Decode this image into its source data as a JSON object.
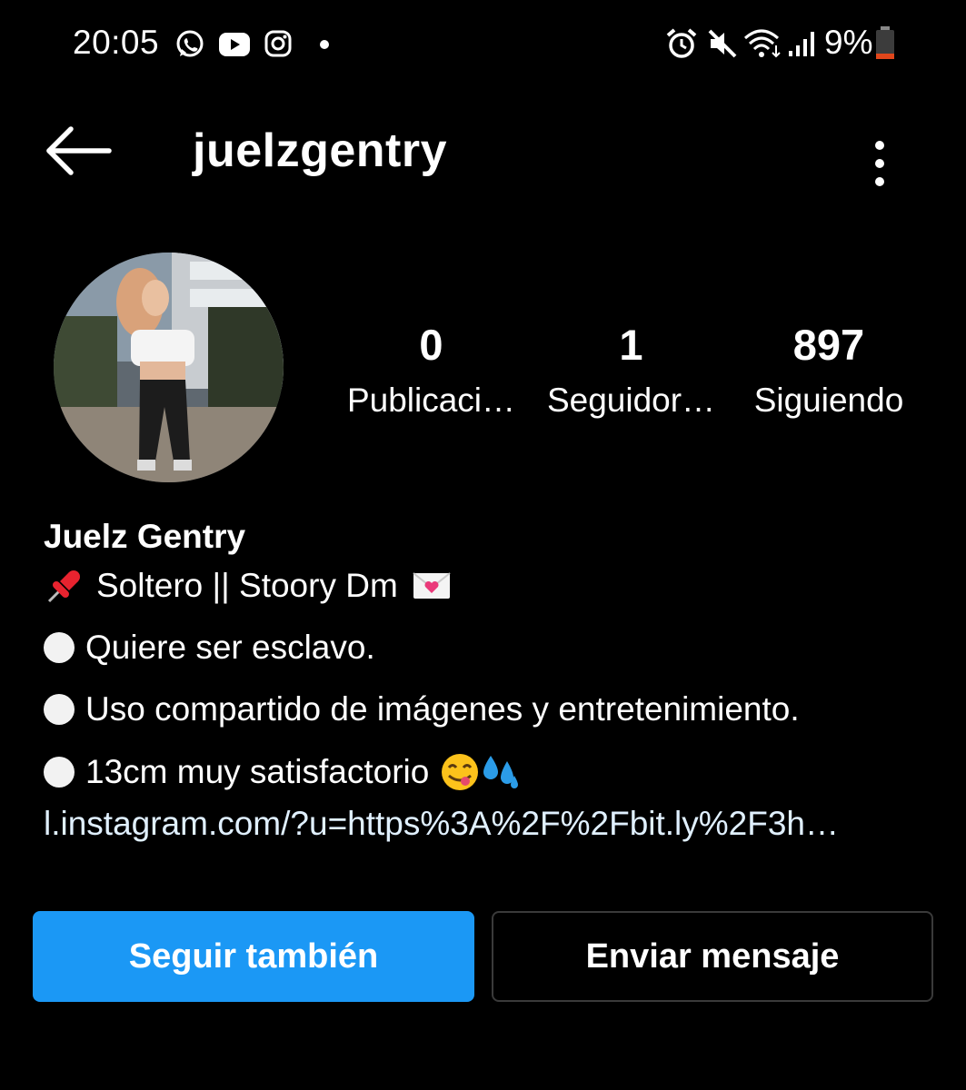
{
  "status_bar": {
    "time": "20:05",
    "notification_icons": [
      "whatsapp-icon",
      "youtube-icon",
      "instagram-icon",
      "dot-icon"
    ],
    "system_icons": [
      "alarm-icon",
      "mute-icon",
      "wifi-icon",
      "signal-icon"
    ],
    "battery": "9%",
    "battery_color": "#e0461b"
  },
  "header": {
    "username": "juelzgentry"
  },
  "stats": [
    {
      "value": "0",
      "label": "Publicaci…"
    },
    {
      "value": "1",
      "label": "Seguidor…"
    },
    {
      "value": "897",
      "label": "Siguiendo"
    }
  ],
  "profile": {
    "full_name": "Juelz Gentry",
    "bio": [
      {
        "prefix_icon": "pushpin-emoji",
        "text": "Soltero || Stoory Dm",
        "suffix_icon": "love-letter-emoji"
      },
      {
        "prefix_icon": "white-circle-emoji",
        "text": "Quiere ser esclavo."
      },
      {
        "prefix_icon": "white-circle-emoji",
        "text": "Uso compartido de imágenes y entretenimiento."
      },
      {
        "prefix_icon": "white-circle-emoji",
        "text": "13cm muy satisfactorio",
        "suffix_icons": [
          "yum-face-emoji",
          "sweat-droplets-emoji"
        ]
      }
    ],
    "link": "l.instagram.com/?u=https%3A%2F%2Fbit.ly%2F3h…"
  },
  "actions": {
    "follow_label": "Seguir también",
    "message_label": "Enviar mensaje",
    "accent": "#1b98f5"
  }
}
